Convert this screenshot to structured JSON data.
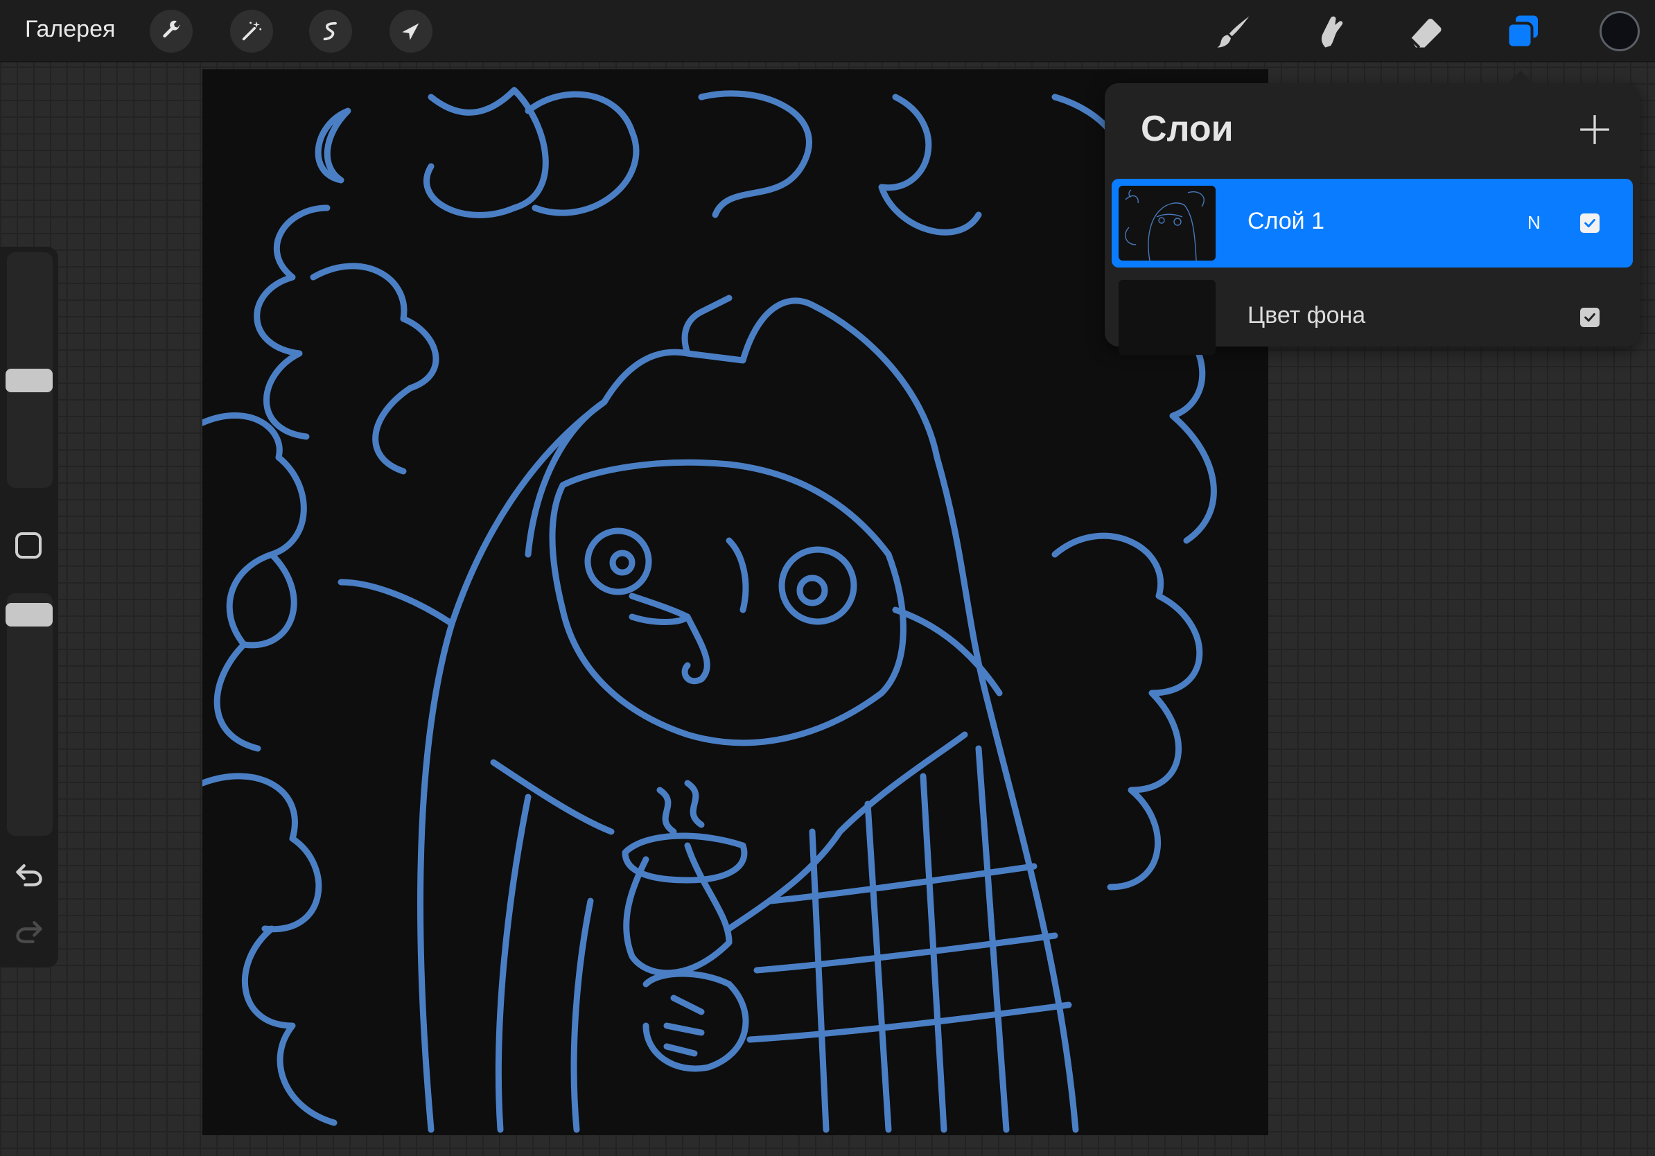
{
  "app": {
    "gallery_label": "Галерея"
  },
  "toolbar": {
    "left_tools": [
      {
        "icon": "wrench-icon",
        "name": "actions"
      },
      {
        "icon": "magic-wand-icon",
        "name": "adjustments"
      },
      {
        "icon": "selection-icon",
        "name": "selection"
      },
      {
        "icon": "arrow-cursor-icon",
        "name": "transform"
      }
    ],
    "right_tools": [
      {
        "icon": "brush-icon",
        "name": "paint"
      },
      {
        "icon": "smudge-icon",
        "name": "smudge"
      },
      {
        "icon": "eraser-icon",
        "name": "erase"
      },
      {
        "icon": "layers-icon",
        "name": "layers",
        "active": true
      }
    ],
    "accent_color": "#0a7cff",
    "current_color": "#0d0f14"
  },
  "sidebar": {
    "brush_size_level": 0.55,
    "opacity_level": 0.95
  },
  "layers_panel": {
    "title": "Слои",
    "add_label": "+",
    "layers": [
      {
        "name": "Слой 1",
        "blend_mode": "N",
        "visible": true,
        "selected": true
      },
      {
        "name": "Цвет фона",
        "visible": true,
        "selected": false
      }
    ]
  },
  "canvas": {
    "background": "#0e0e0e",
    "stroke_color": "#4f86cf"
  }
}
